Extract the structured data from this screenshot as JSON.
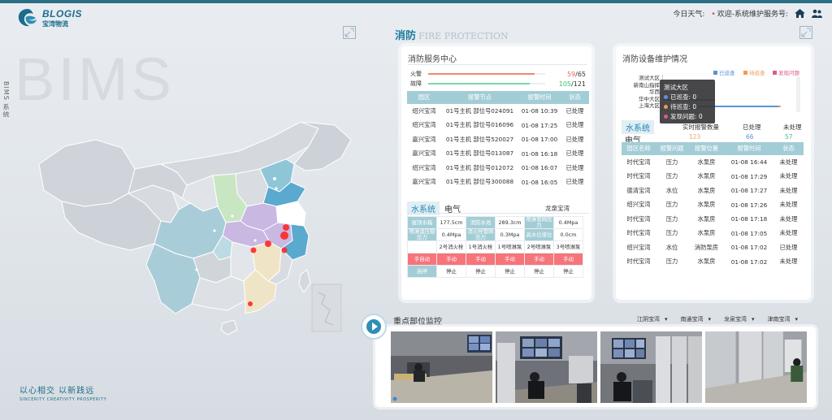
{
  "header": {
    "logo_en": "BLOGIS",
    "logo_cn": "宝湾物流",
    "weather": "今日天气:",
    "welcome": "欢迎-系统维护服务号:"
  },
  "left": {
    "bg_text": "BIMS",
    "system_label": "BIMS 系统",
    "slogan_cn": "以心相交  以新践远",
    "slogan_en": "SINCERITY   CREATIVITY   PROSPERITY"
  },
  "section": {
    "title_cn": "消防",
    "title_en": "FIRE PROTECTION"
  },
  "fire_center": {
    "title": "消防服务中心",
    "rows": [
      {
        "label": "火警",
        "current": "59",
        "total": "/65",
        "fraction": 0.91,
        "color": "#f0876a",
        "value_color": "#e96a53"
      },
      {
        "label": "故障",
        "current": "105",
        "total": "/121",
        "fraction": 0.87,
        "color": "#7ad7a6",
        "value_color": "#3bbf7a"
      }
    ],
    "table": {
      "headers": [
        "园区",
        "报警节点",
        "报警时间",
        "状态"
      ],
      "rows": [
        [
          "绍兴宝湾",
          "01号主机 部位号024091",
          "01-08 10:39",
          "已处理"
        ],
        [
          "绍兴宝湾",
          "01号主机 部位号016096",
          "01-08 17:25",
          "已处理"
        ],
        [
          "嘉兴宝湾",
          "01号主机 部位号520027",
          "01-08 17:00",
          "已处理"
        ],
        [
          "嘉兴宝湾",
          "01号主机 部位号013087",
          "01-08 16:18",
          "已处理"
        ],
        [
          "绍兴宝湾",
          "01号主机 部位号012072",
          "01-08 16:07",
          "已处理"
        ],
        [
          "嘉兴宝湾",
          "01号主机 部位号300088",
          "01-08 16:05",
          "已处理"
        ]
      ]
    },
    "tabs": [
      "水系统",
      "电气"
    ],
    "location": "龙泉宝湾",
    "grid": [
      [
        {
          "t": "屋顶水箱",
          "c": "h"
        },
        {
          "t": "177.5cm"
        },
        {
          "t": "消防水池",
          "c": "h"
        },
        {
          "t": "289.3cm"
        },
        {
          "t": "喷淋管网压力",
          "c": "h"
        },
        {
          "t": "0.4Mpa"
        }
      ],
      [
        {
          "t": "喷淋湿压稳压力",
          "c": "h"
        },
        {
          "t": "0.4Mpa"
        },
        {
          "t": "消火栓管网压力",
          "c": "h"
        },
        {
          "t": "0.3Mpa"
        },
        {
          "t": "高水位液位",
          "c": "h"
        },
        {
          "t": "0.0cm"
        }
      ],
      [
        {
          "t": ""
        },
        {
          "t": "2号消火栓"
        },
        {
          "t": "1号消火栓"
        },
        {
          "t": "1号喷淋泵"
        },
        {
          "t": "2号喷淋泵"
        },
        {
          "t": "3号喷淋泵"
        }
      ],
      [
        {
          "t": "手自动",
          "c": "red"
        },
        {
          "t": "手动",
          "c": "red"
        },
        {
          "t": "手动",
          "c": "red"
        },
        {
          "t": "手动",
          "c": "red"
        },
        {
          "t": "手动",
          "c": "red"
        },
        {
          "t": "手动",
          "c": "red"
        }
      ],
      [
        {
          "t": "启停",
          "c": "h"
        },
        {
          "t": "停止"
        },
        {
          "t": "停止"
        },
        {
          "t": "停止"
        },
        {
          "t": "停止"
        },
        {
          "t": "停止"
        }
      ]
    ]
  },
  "maintenance": {
    "title": "消防设备维护情况",
    "legend": [
      {
        "label": "已巡查",
        "color": "#5a93d8"
      },
      {
        "label": "待巡查",
        "color": "#f39a55"
      },
      {
        "label": "发现问题",
        "color": "#e05a8a"
      }
    ],
    "zones": [
      "测试大区",
      "新南山指挥",
      "华西",
      "华中大区",
      "上海大区"
    ],
    "popup": {
      "title": "测试大区",
      "rows": [
        {
          "label": "已巡查: 0",
          "color": "#5a93d8"
        },
        {
          "label": "待巡查: 0",
          "color": "#f39a55"
        },
        {
          "label": "发现问题: 0",
          "color": "#e05a8a"
        }
      ]
    },
    "tabs": [
      "水系统",
      "电气"
    ],
    "summary": {
      "labels": [
        "实时报警数量",
        "已处理",
        "未处理"
      ],
      "values": [
        "123",
        "66",
        "57"
      ],
      "colors": [
        "#f0a560",
        "#5a93d8",
        "#43c18a"
      ]
    },
    "table": {
      "headers": [
        "园区名称",
        "报警问题",
        "报警位置",
        "报警时间",
        "状态"
      ],
      "rows": [
        [
          "时代宝湾",
          "压力",
          "水泵房",
          "01-08 16:44",
          "未处理"
        ],
        [
          "时代宝湾",
          "压力",
          "水泵房",
          "01-08 17:29",
          "未处理"
        ],
        [
          "德清宝湾",
          "水位",
          "水泵房",
          "01-08 17:27",
          "未处理"
        ],
        [
          "绍兴宝湾",
          "压力",
          "水泵房",
          "01-08 17:26",
          "未处理"
        ],
        [
          "时代宝湾",
          "压力",
          "水泵房",
          "01-08 17:18",
          "未处理"
        ],
        [
          "时代宝湾",
          "压力",
          "水泵房",
          "01-08 17:05",
          "未处理"
        ],
        [
          "绍兴宝湾",
          "水位",
          "消防泵房",
          "01-08 17:02",
          "已处理"
        ],
        [
          "时代宝湾",
          "压力",
          "水泵房",
          "01-08 17:02",
          "未处理"
        ]
      ]
    }
  },
  "video": {
    "title": "重点部位监控",
    "filters": [
      "江阴宝湾",
      "南通宝湾",
      "龙泉宝湾",
      "津南宝湾"
    ]
  }
}
